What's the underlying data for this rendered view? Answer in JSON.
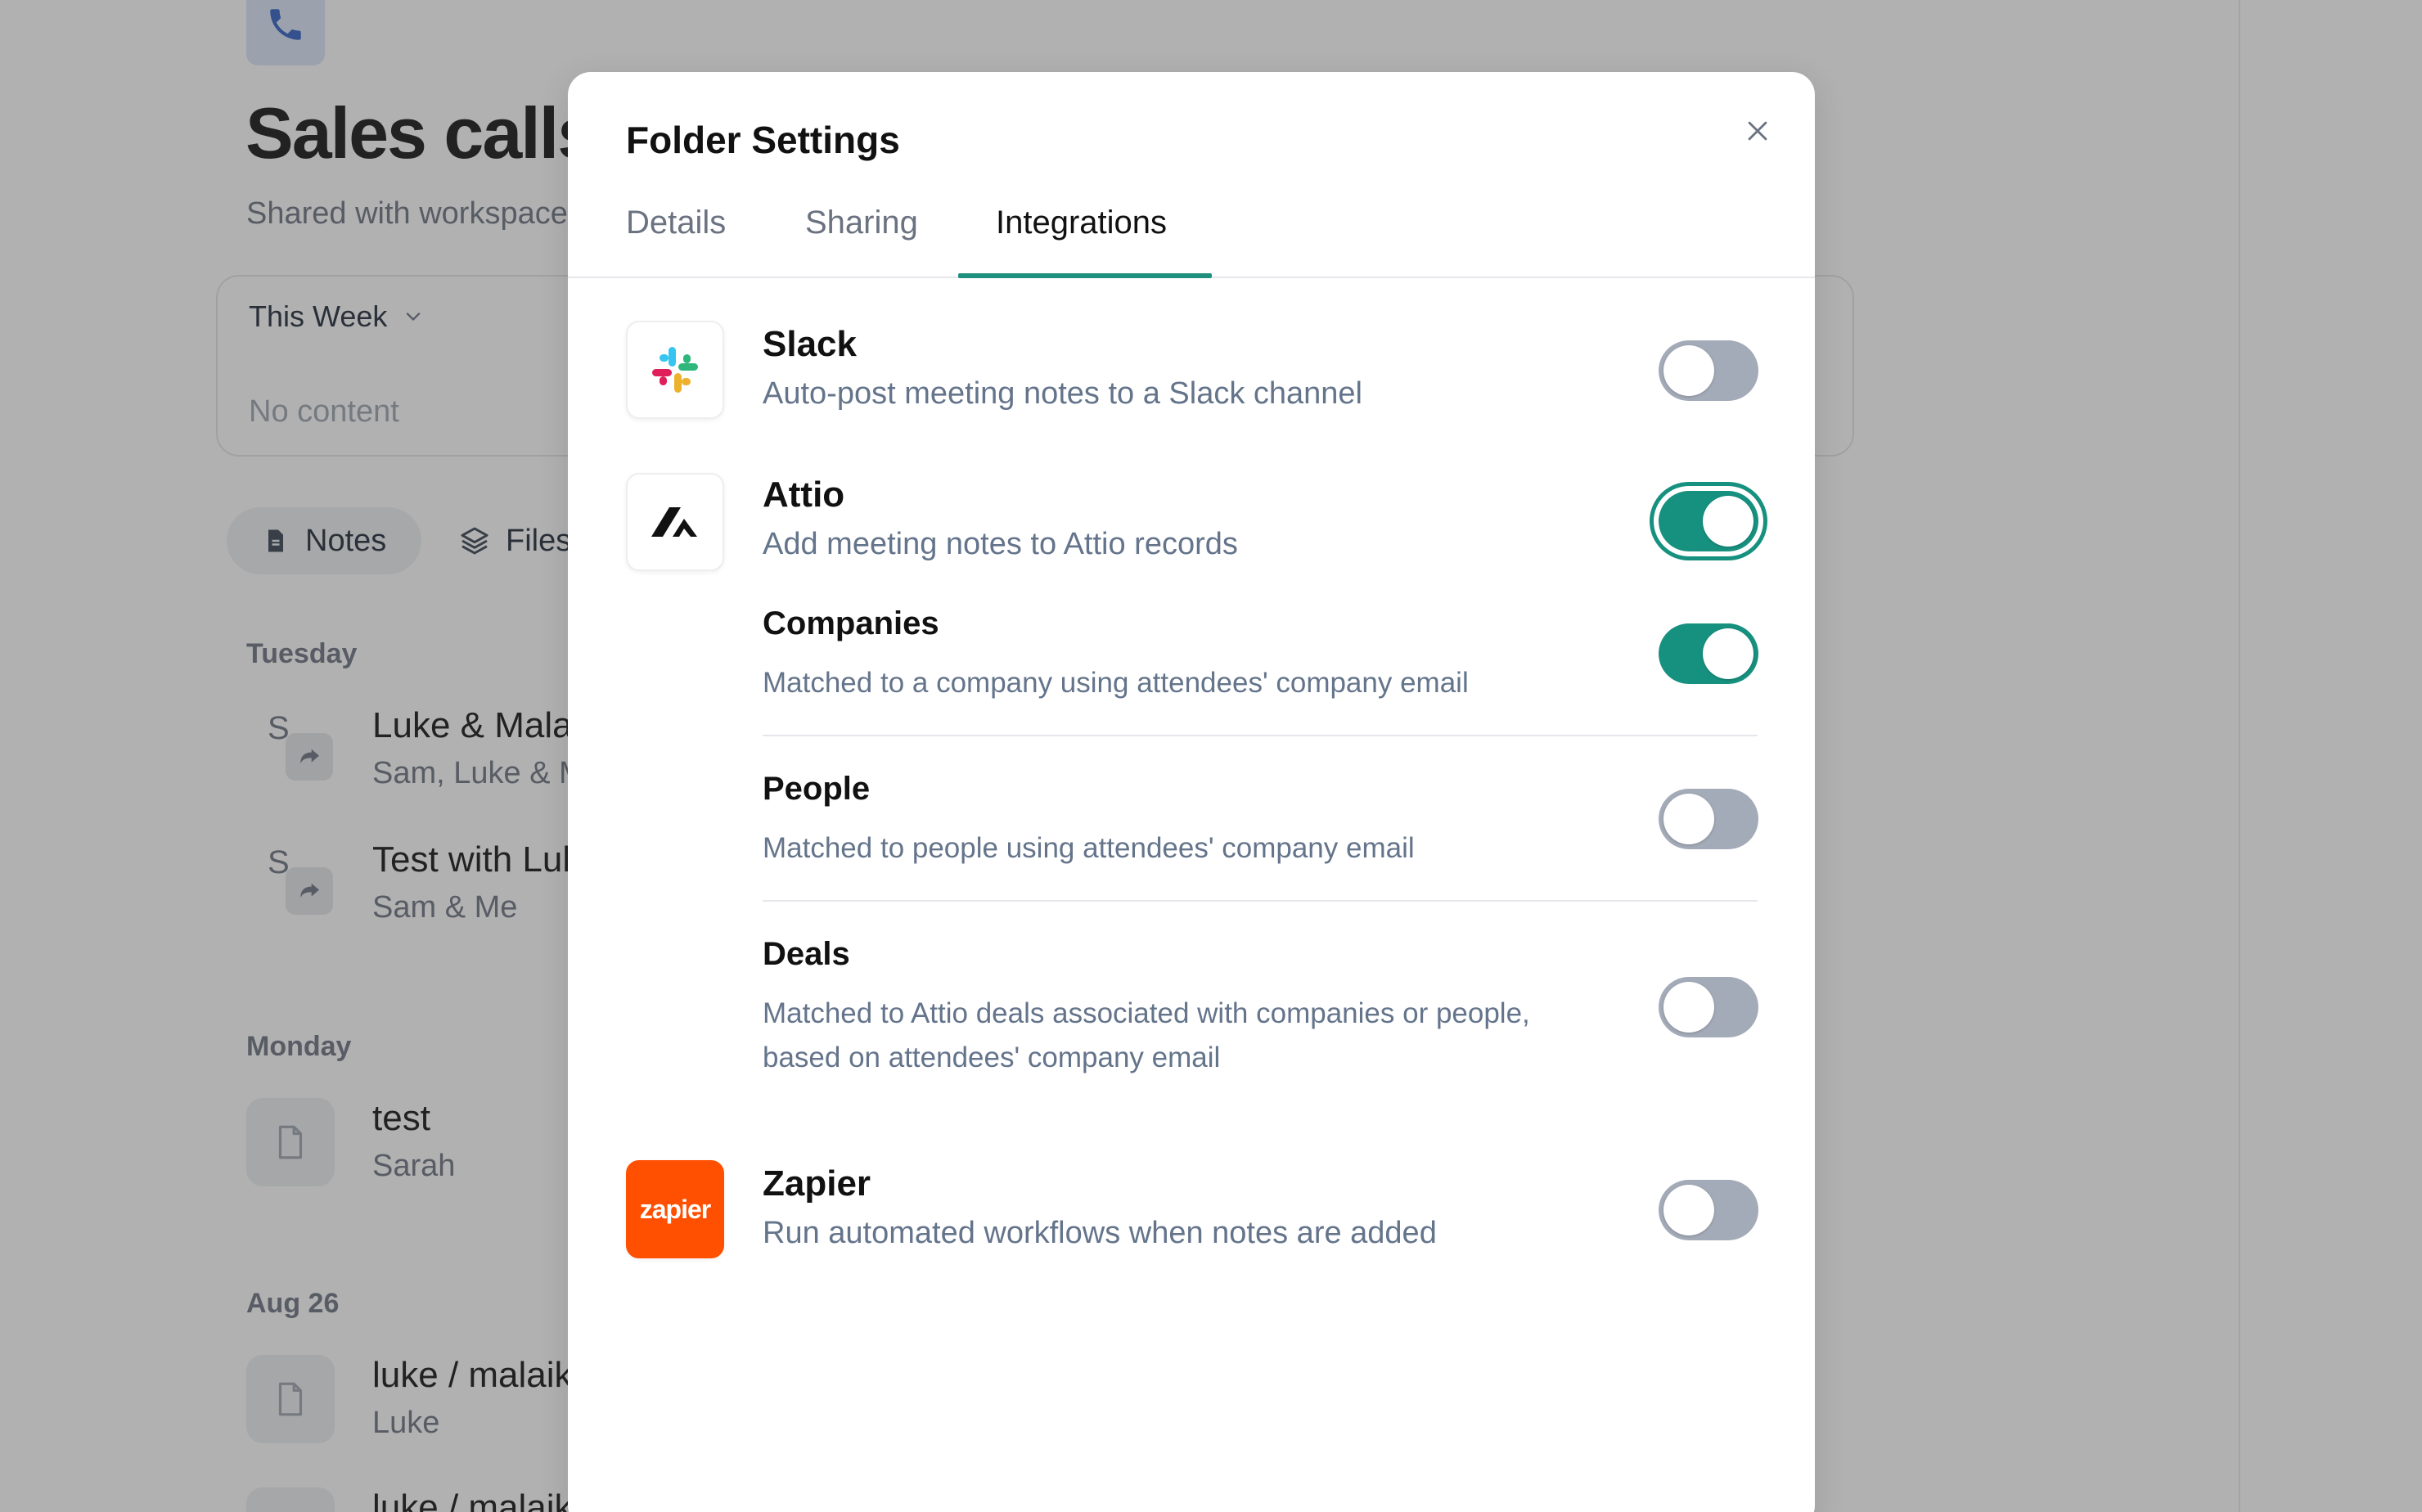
{
  "background": {
    "page_title": "Sales calls",
    "page_subtitle": "Shared with workspace",
    "week_filter": "This Week",
    "no_content": "No content",
    "chips": {
      "notes": "Notes",
      "files": "Files"
    },
    "groups": [
      {
        "day": "Tuesday",
        "notes": [
          {
            "avatar": "S",
            "title": "Luke & Malaika",
            "sub": "Sam, Luke & Me"
          },
          {
            "avatar": "S",
            "title": "Test with Luke",
            "sub": "Sam & Me"
          }
        ]
      },
      {
        "day": "Monday",
        "notes": [
          {
            "title": "test",
            "sub": "Sarah"
          }
        ]
      },
      {
        "day": "Aug 26",
        "notes": [
          {
            "title": "luke / malaika",
            "sub": "Luke"
          },
          {
            "title": "luke / malaika",
            "sub": ""
          }
        ]
      }
    ]
  },
  "modal": {
    "title": "Folder Settings",
    "tabs": [
      {
        "label": "Details",
        "active": false
      },
      {
        "label": "Sharing",
        "active": false
      },
      {
        "label": "Integrations",
        "active": true
      }
    ],
    "integrations": {
      "slack": {
        "name": "Slack",
        "description": "Auto-post meeting notes to a Slack channel",
        "enabled": false
      },
      "attio": {
        "name": "Attio",
        "description": "Add meeting notes to Attio records",
        "enabled": true,
        "objects": [
          {
            "name": "Companies",
            "description": "Matched to a company using attendees' company email",
            "enabled": true
          },
          {
            "name": "People",
            "description": "Matched to people using attendees' company email",
            "enabled": false
          },
          {
            "name": "Deals",
            "description_line1": "Matched to Attio deals associated with companies or people,",
            "description_line2": "based on attendees' company email",
            "enabled": false
          }
        ]
      },
      "zapier": {
        "name": "Zapier",
        "logo_text": "zapier",
        "description": "Run automated workflows when notes are added",
        "enabled": false
      }
    }
  },
  "colors": {
    "accent": "#17917f",
    "toggle_off": "#a4abb8",
    "zapier": "#ff4f00",
    "overlay": "rgba(60,60,60,0.40)"
  },
  "icons": [
    "phone-icon",
    "chevron-down-icon",
    "document-icon",
    "layers-icon",
    "share-icon",
    "close-icon",
    "slack-logo-icon",
    "attio-logo-icon",
    "zapier-logo-icon"
  ]
}
